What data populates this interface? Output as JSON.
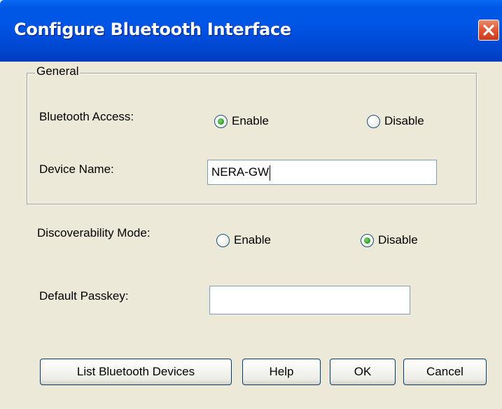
{
  "window": {
    "title": "Configure Bluetooth Interface"
  },
  "colors": {
    "titlebar": "#0055e5",
    "dialog_background": "#ece9d8",
    "close_button": "#e05a37",
    "radio_checked": "#3aa634"
  },
  "icons": {
    "close": "close-icon",
    "radio": "radio-button"
  },
  "general": {
    "legend": "General",
    "bluetooth_access": {
      "label": "Bluetooth Access:",
      "options": [
        "Enable",
        "Disable"
      ],
      "selected": "Enable"
    },
    "device_name": {
      "label": "Device Name:",
      "value": "NERA-GW"
    }
  },
  "discoverability": {
    "label": "Discoverability Mode:",
    "options": [
      "Enable",
      "Disable"
    ],
    "selected": "Disable"
  },
  "passkey": {
    "label": "Default Passkey:",
    "value": ""
  },
  "buttons": {
    "list_devices": "List Bluetooth Devices",
    "help": "Help",
    "ok": "OK",
    "cancel": "Cancel"
  }
}
